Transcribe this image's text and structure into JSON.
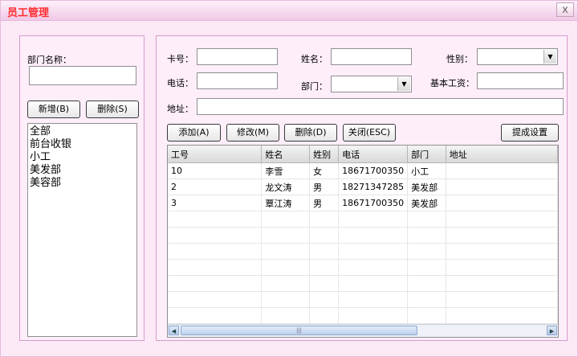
{
  "window": {
    "title": "员工管理",
    "close_label": "x"
  },
  "left": {
    "dept_name_label": "部门名称：",
    "dept_name_value": "",
    "add_label": "新增(B)",
    "delete_label": "删除(S)",
    "departments": [
      "全部",
      "前台收银",
      "小工",
      "美发部",
      "美容部"
    ]
  },
  "form": {
    "card_label": "卡号：",
    "name_label": "姓名：",
    "gender_label": "性别：",
    "phone_label": "电话：",
    "dept_label": "部门：",
    "salary_label": "基本工资：",
    "address_label": "地址："
  },
  "actions": {
    "add_label": "添加(A)",
    "edit_label": "修改(M)",
    "delete_label": "删除(D)",
    "close_label": "关闭(ESC)",
    "commission_label": "提成设置"
  },
  "table": {
    "columns": [
      "工号",
      "姓名",
      "姓别",
      "电话",
      "部门",
      "地址"
    ],
    "rows": [
      [
        "10",
        "李雪",
        "女",
        "18671700350",
        "小工",
        ""
      ],
      [
        "2",
        "龙文涛",
        "男",
        "18271347285",
        "美发部",
        ""
      ],
      [
        "3",
        "覃江涛",
        "男",
        "18671700350",
        "美发部",
        ""
      ]
    ],
    "empty_rows": 9
  },
  "icons": {
    "close": "close-icon",
    "dropdown": "chevron-down-icon",
    "scroll_left": "arrow-left-icon",
    "scroll_right": "arrow-right-icon"
  }
}
